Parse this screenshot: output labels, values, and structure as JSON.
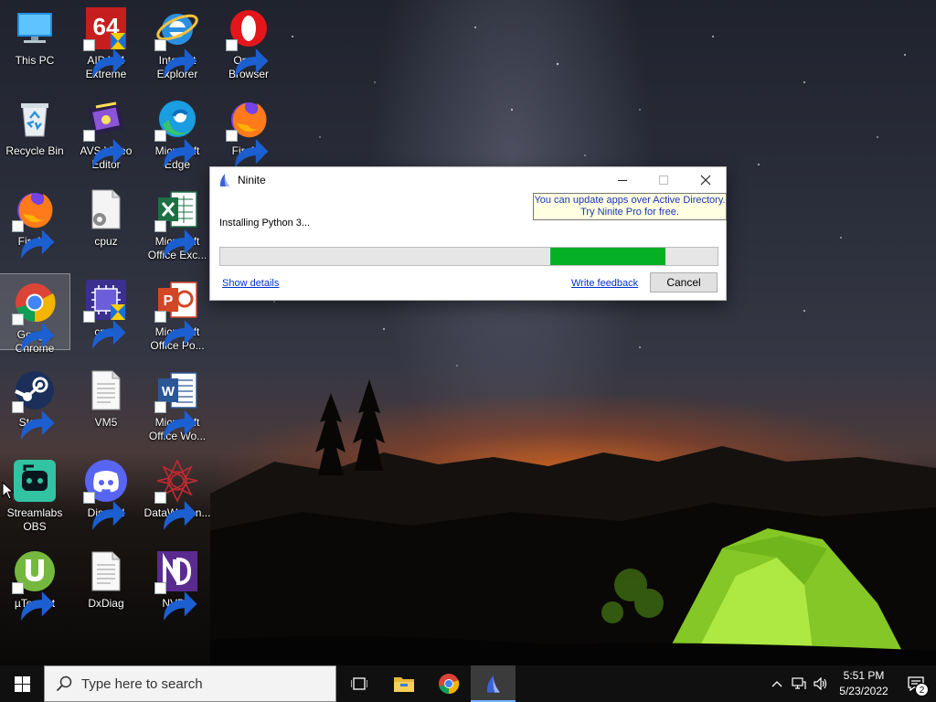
{
  "desktop": {
    "icons": [
      {
        "label": "This PC",
        "icon": "computer-icon",
        "shortcut": false
      },
      {
        "label": "AIDA64\nExtreme",
        "icon": "aida64-icon",
        "shortcut": true
      },
      {
        "label": "Internet\nExplorer",
        "icon": "internet-explorer-icon",
        "shortcut": true
      },
      {
        "label": "Opera\nBrowser",
        "icon": "opera-icon",
        "shortcut": true
      },
      {
        "label": "Recycle Bin",
        "icon": "recycle-bin-icon",
        "shortcut": false
      },
      {
        "label": "AVS Video\nEditor",
        "icon": "avs-video-editor-icon",
        "shortcut": true
      },
      {
        "label": "Microsoft\nEdge",
        "icon": "edge-icon",
        "shortcut": true
      },
      {
        "label": "Firefox",
        "icon": "firefox-icon",
        "shortcut": true
      },
      {
        "label": "Firefox",
        "icon": "firefox-icon",
        "shortcut": true
      },
      {
        "label": "cpuz",
        "icon": "settings-file-icon",
        "shortcut": false
      },
      {
        "label": "Microsoft\nOffice Exc...",
        "icon": "excel-icon",
        "shortcut": true
      },
      {
        "label": "Google\nChrome",
        "icon": "chrome-icon",
        "shortcut": true,
        "selected": true
      },
      {
        "label": "cpuz",
        "icon": "cpuz-icon",
        "shortcut": true
      },
      {
        "label": "Microsoft\nOffice Po...",
        "icon": "powerpoint-icon",
        "shortcut": true
      },
      {
        "label": "Steam",
        "icon": "steam-icon",
        "shortcut": true
      },
      {
        "label": "VM5",
        "icon": "text-file-icon",
        "shortcut": false
      },
      {
        "label": "Microsoft\nOffice Wo...",
        "icon": "word-icon",
        "shortcut": true
      },
      {
        "label": "Streamlabs\nOBS",
        "icon": "streamlabs-icon",
        "shortcut": false
      },
      {
        "label": "Discord",
        "icon": "discord-icon",
        "shortcut": true
      },
      {
        "label": "DataWagon...",
        "icon": "datawagon-icon",
        "shortcut": true
      },
      {
        "label": "µTorrent",
        "icon": "utorrent-icon",
        "shortcut": true
      },
      {
        "label": "DxDiag",
        "icon": "text-file-icon",
        "shortcut": false
      },
      {
        "label": "NVDA",
        "icon": "nvda-icon",
        "shortcut": true
      }
    ]
  },
  "ninite": {
    "title": "Ninite",
    "tooltip_line1": "You can update apps over Active Directory.",
    "tooltip_line2": "Try Ninite Pro for free.",
    "status": "Installing Python 3...",
    "progress_start": 0.663,
    "progress_end": 0.895,
    "show_details": "Show details",
    "write_feedback": "Write feedback",
    "cancel": "Cancel"
  },
  "taskbar": {
    "search_placeholder": "Type here to search",
    "time": "5:51 PM",
    "date": "5/23/2022",
    "notifications": "2",
    "accent": "#7ab0ff"
  }
}
